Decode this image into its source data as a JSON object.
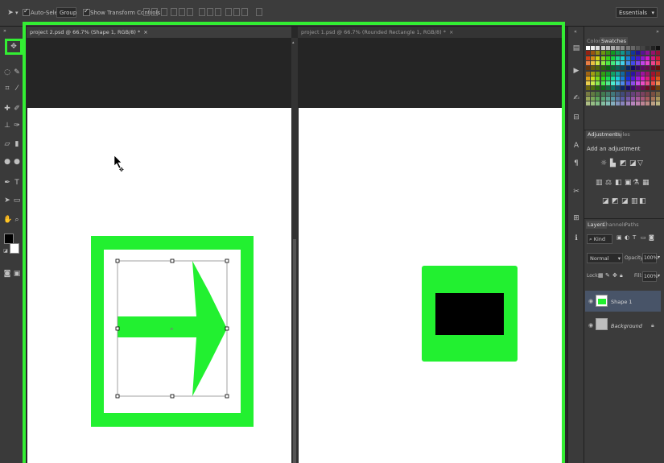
{
  "options_bar": {
    "auto_select_label": "Auto-Select:",
    "auto_select_value": "Group",
    "show_transform_label": "Show Transform Controls",
    "workspace": "Essentials"
  },
  "documents": [
    {
      "tab_label": "project 2.psd @ 66.7% (Shape 1, RGB/8) *",
      "close": "×"
    },
    {
      "tab_label": "project 1.psd @ 66.7% (Rounded Rectangle 1, RGB/8) *",
      "close": "×"
    }
  ],
  "colors": {
    "highlight": "#33ee33",
    "shape_green": "#22f030",
    "black": "#000000"
  },
  "panels": {
    "color_tabs": [
      "Color",
      "Swatches"
    ],
    "adjustment_tabs": [
      "Adjustments",
      "Styles"
    ],
    "adjustment_title": "Add an adjustment",
    "layer_tabs": [
      "Layers",
      "Channels",
      "Paths"
    ],
    "kind_filter": "Kind",
    "blend_mode": "Normal",
    "opacity_label": "Opacity:",
    "opacity_value": "100%",
    "lock_label": "Lock:",
    "fill_label": "Fill:",
    "fill_value": "100%",
    "layers": [
      {
        "name": "Shape 1"
      },
      {
        "name": "Background"
      }
    ]
  }
}
